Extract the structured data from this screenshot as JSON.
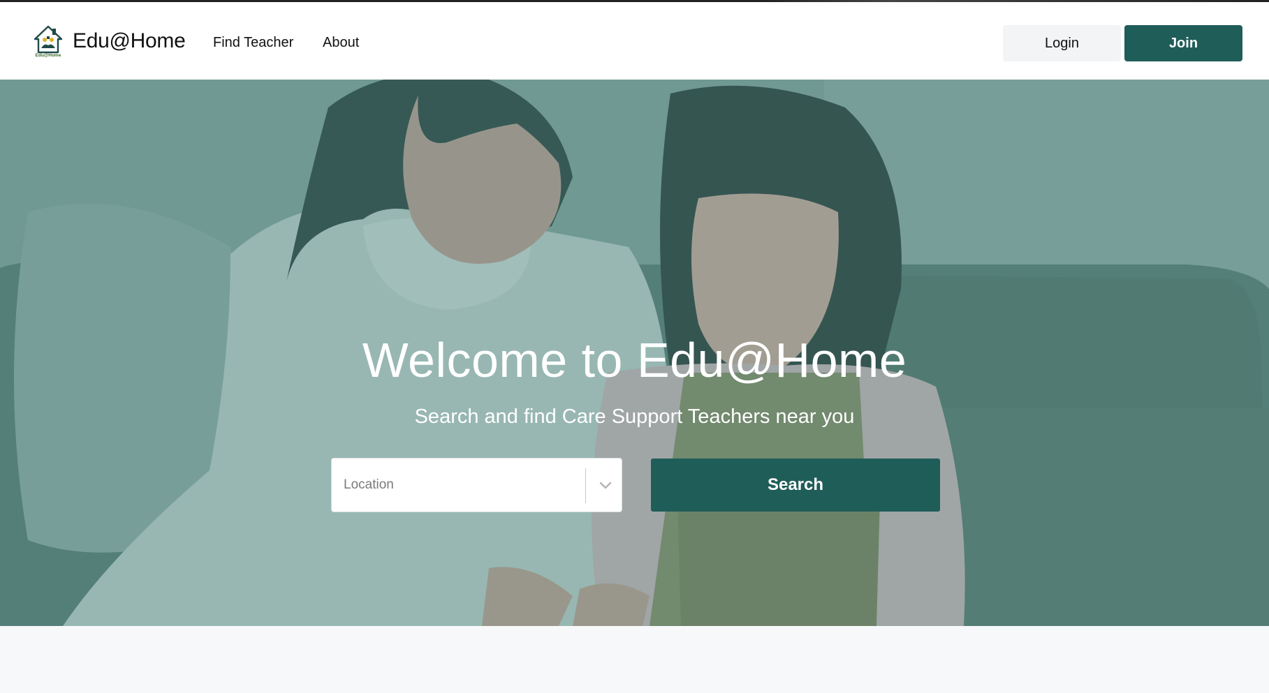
{
  "navbar": {
    "brand_name": "Edu@Home",
    "logo_text": "Edu@Home",
    "links": [
      {
        "label": "Find Teacher"
      },
      {
        "label": "About"
      }
    ],
    "login_label": "Login",
    "join_label": "Join"
  },
  "hero": {
    "title": "Welcome to Edu@Home",
    "subtitle": "Search and find Care Support Teachers near you",
    "location_placeholder": "Location",
    "search_label": "Search"
  },
  "colors": {
    "accent": "#1f5d59",
    "hero_overlay": "#5f8a84",
    "page_background": "#f7f8fa"
  }
}
